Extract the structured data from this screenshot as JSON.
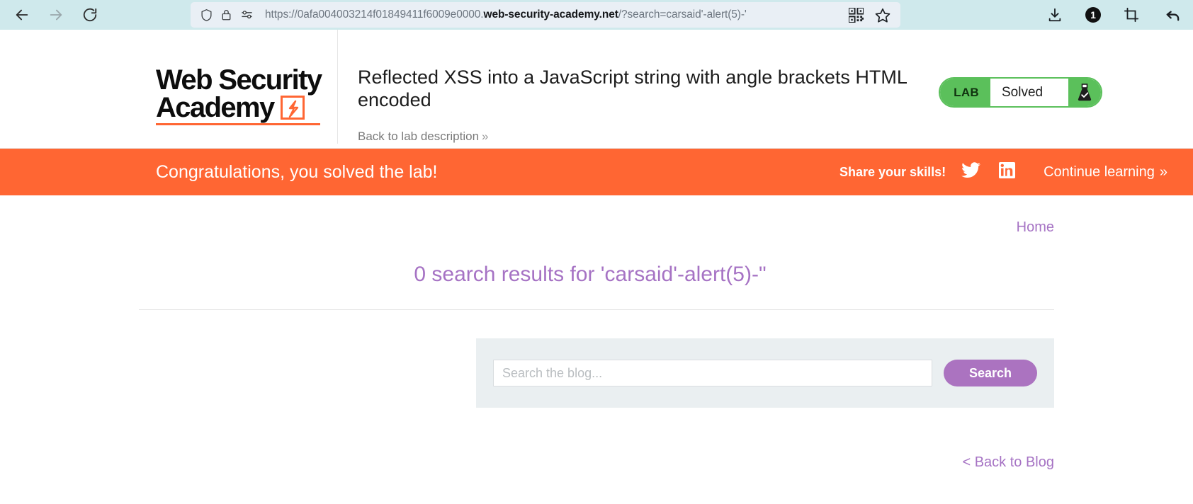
{
  "browser": {
    "nav": {
      "back_icon": "arrow-left-icon",
      "forward_icon": "arrow-right-icon",
      "reload_icon": "reload-icon"
    },
    "url_bar": {
      "shield_icon": "shield-icon",
      "lock_icon": "lock-icon",
      "permissions_icon": "permissions-key-icon",
      "url_prefix": "https://0afa004003214f01849411f6009e0000.",
      "url_domain": "web-security-academy.net",
      "url_suffix": "/?search=carsaid'-alert(5)-'",
      "full_url": "https://0afa004003214f01849411f6009e0000.web-security-academy.net/?search=carsaid'-alert(5)-'",
      "qr_icon": "qr-code-icon",
      "bookmark_icon": "star-bookmark-icon"
    },
    "toolbar": {
      "download_icon": "download-icon",
      "notification_count": "1",
      "crop_icon": "crop-icon",
      "undo_icon": "undo-arrow-icon"
    }
  },
  "header": {
    "logo": {
      "line1": "Web Security",
      "line2": "Academy",
      "flask_icon": "orange-flask-logo-icon"
    },
    "lab_title": "Reflected XSS into a JavaScript string with angle brackets HTML encoded",
    "back_link": "Back to lab description",
    "back_link_chevron": "»",
    "status": {
      "tag": "LAB",
      "state": "Solved",
      "icon": "flask-check-icon",
      "accent_color": "#5bc05b"
    }
  },
  "banner": {
    "message": "Congratulations, you solved the lab!",
    "share_label": "Share your skills!",
    "twitter_icon": "twitter-icon",
    "linkedin_icon": "linkedin-icon",
    "continue_label": "Continue learning",
    "continue_chevron": "»",
    "background_color": "#ff6633"
  },
  "content": {
    "home_link": "Home",
    "results_heading": "0 search results for 'carsaid'-alert(5)-\"",
    "search": {
      "placeholder": "Search the blog...",
      "value": "",
      "button_label": "Search"
    },
    "back_to_blog": "< Back to Blog",
    "accent_color": "#a673c4"
  }
}
